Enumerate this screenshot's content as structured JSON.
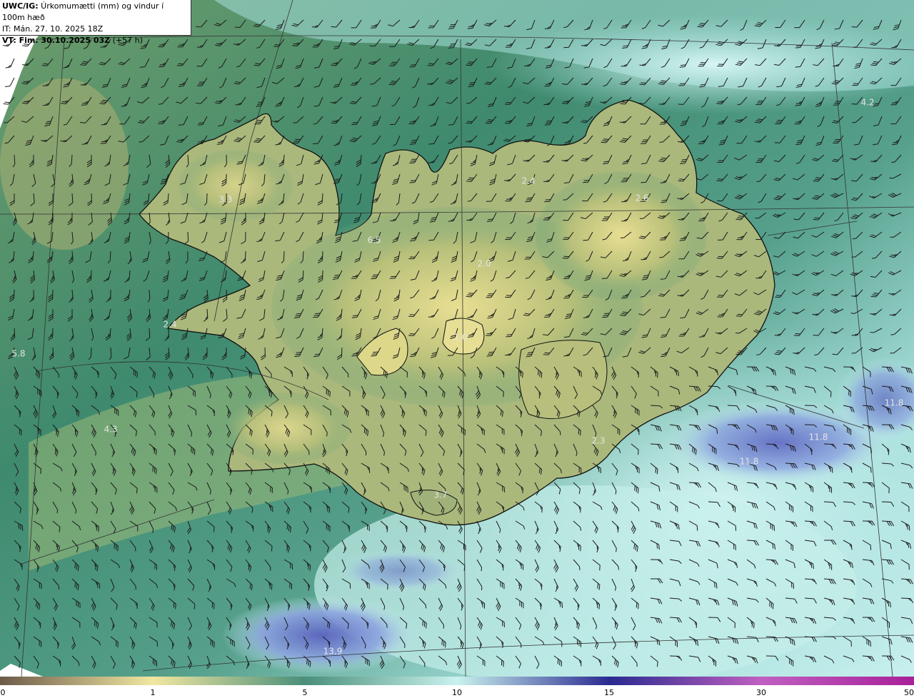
{
  "header": {
    "line1_prefix": "UWC/IG:",
    "line1_text": " Úrkomumætti (mm) og vindur í 100m hæð",
    "line2": "IT: Mán. 27. 10. 2025 18Z",
    "line3_prefix": "VT: Fim. 30.10.2025 03Z",
    "line3_text": " (+57 h)"
  },
  "value_labels": [
    "4.2",
    "3.3",
    "2.4",
    "2.6",
    "6.5",
    "2.0",
    "5.8",
    "2.4",
    "1.0",
    "4.3",
    "11.8",
    "11.8",
    "11.8",
    "2.3",
    "3.7",
    "13.9"
  ],
  "colorbar": {
    "ticks": [
      "0",
      "1",
      "5",
      "10",
      "15",
      "30",
      "50"
    ],
    "colors": [
      "#6e5a4a",
      "#f2e7a0",
      "#4a8f7a",
      "#c9f2ee",
      "#2a2a90",
      "#c060c0",
      "#a8209a"
    ]
  },
  "colors": {
    "land_outline": "#111111",
    "grid": "#333333",
    "barb": "#1a1a1a"
  }
}
